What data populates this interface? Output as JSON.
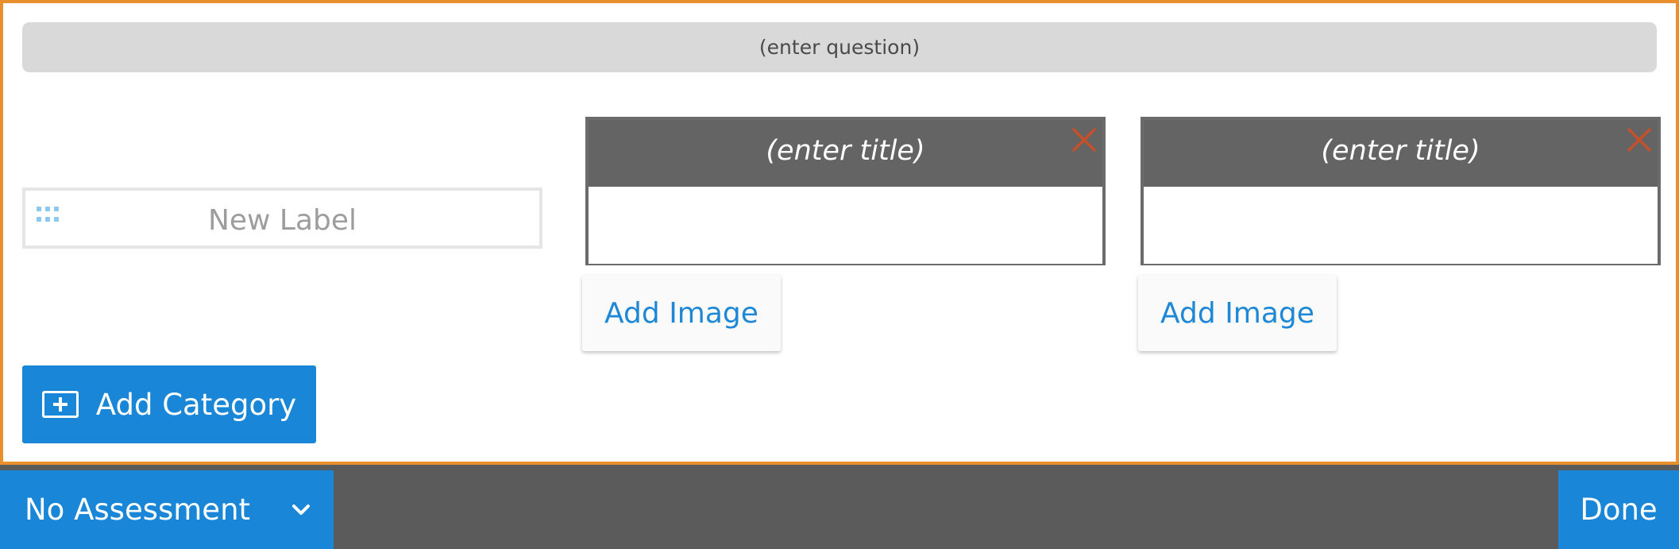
{
  "question": {
    "placeholder": "(enter question)"
  },
  "label": {
    "text": "New Label"
  },
  "categories": [
    {
      "title": "(enter title)",
      "add_image_label": "Add Image"
    },
    {
      "title": "(enter title)",
      "add_image_label": "Add Image"
    }
  ],
  "add_category": {
    "label": "Add Category",
    "icon": "plus-box-icon"
  },
  "footer": {
    "assessment": {
      "selected": "No Assessment",
      "icon": "chevron-down-icon"
    },
    "done_label": "Done"
  },
  "colors": {
    "accent": "#1a86d8",
    "editor_border": "#e8902e",
    "category_header": "#646464",
    "close_icon": "#c4502c",
    "footer_bg": "#5b5b5b"
  }
}
